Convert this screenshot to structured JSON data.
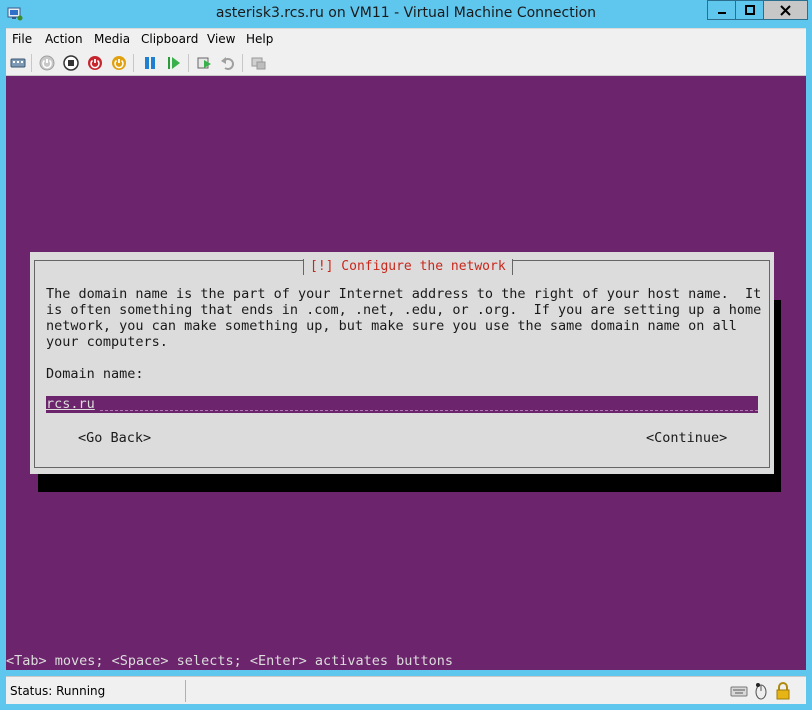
{
  "window": {
    "title": "asterisk3.rcs.ru on VM11 - Virtual Machine Connection",
    "controls": [
      "minimize",
      "maximize",
      "close"
    ]
  },
  "menu": {
    "items": [
      "File",
      "Action",
      "Media",
      "Clipboard",
      "View",
      "Help"
    ]
  },
  "toolbar": {
    "icons": [
      "ctrl-alt-del-icon",
      "start-icon",
      "turn-off-icon",
      "shut-down-icon",
      "power-icon",
      "pause-icon",
      "resume-icon",
      "checkpoint-icon",
      "revert-icon",
      "enhanced-session-icon"
    ]
  },
  "console": {
    "background": "#6c256c",
    "dialog": {
      "title": "[!] Configure the network",
      "body": "The domain name is the part of your Internet address to the right of your host name.  It\nis often something that ends in .com, .net, .edu, or .org.  If you are setting up a home\nnetwork, you can make something up, but make sure you use the same domain name on all\nyour computers.",
      "field_label": "Domain name:",
      "field_value": "rcs.ru",
      "go_back": "<Go Back>",
      "continue": "<Continue>"
    },
    "help_line": "<Tab> moves; <Space> selects; <Enter> activates buttons"
  },
  "statusbar": {
    "status": "Status: Running",
    "icons": [
      "keyboard-icon",
      "mouse-icon",
      "lock-icon"
    ]
  }
}
